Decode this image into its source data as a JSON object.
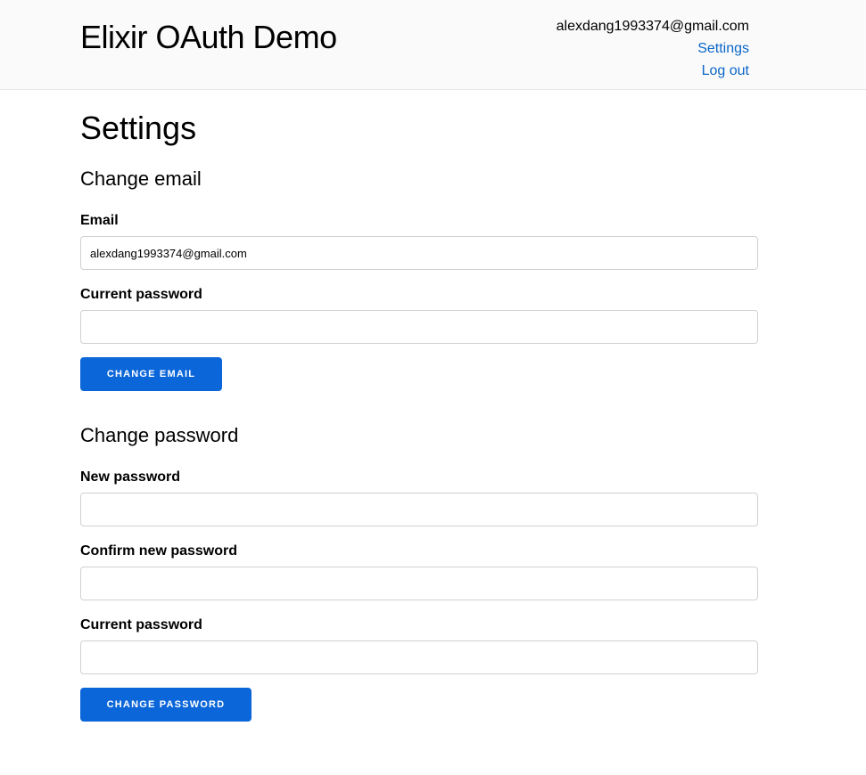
{
  "header": {
    "brand": "Elixir OAuth Demo",
    "user_email": "alexdang1993374@gmail.com",
    "settings_link": "Settings",
    "logout_link": "Log out"
  },
  "page": {
    "title": "Settings"
  },
  "change_email": {
    "heading": "Change email",
    "email_label": "Email",
    "email_value": "alexdang1993374@gmail.com",
    "current_password_label": "Current password",
    "current_password_value": "",
    "button_label": "CHANGE EMAIL"
  },
  "change_password": {
    "heading": "Change password",
    "new_password_label": "New password",
    "new_password_value": "",
    "confirm_password_label": "Confirm new password",
    "confirm_password_value": "",
    "current_password_label": "Current password",
    "current_password_value": "",
    "button_label": "CHANGE PASSWORD"
  },
  "colors": {
    "accent": "#0b66d9",
    "link": "#0b66c8",
    "header_bg": "#fafafa"
  }
}
